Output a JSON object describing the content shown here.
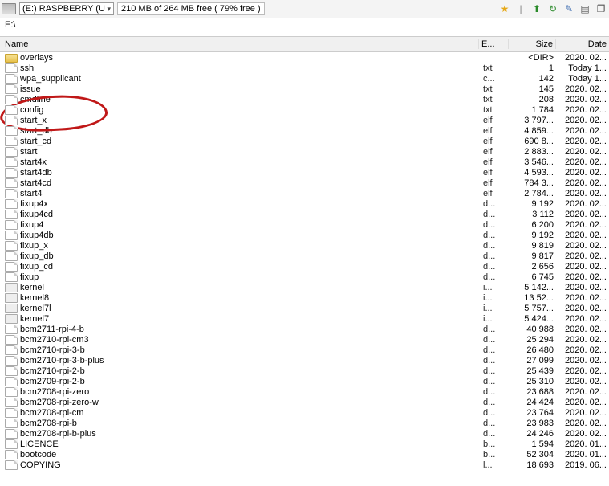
{
  "toolbar": {
    "drive_label": "(E:) RASPBERRY (U",
    "free_space": "210 MB of 264 MB free ( 79% free )"
  },
  "icons": {
    "star": "⭐",
    "sep": "|",
    "up": "⬆",
    "refresh": "↻",
    "tool": "✎",
    "grid": "▤",
    "win": "❐"
  },
  "path": "E:\\",
  "headers": {
    "name": "Name",
    "ext": "E...",
    "size": "Size",
    "date": "Date"
  },
  "files": [
    {
      "icon": "folder",
      "name": "overlays",
      "ext": "",
      "size": "<DIR>",
      "date": "2020. 02..."
    },
    {
      "icon": "file",
      "name": "ssh",
      "ext": "txt",
      "size": "1",
      "date": "Today 1..."
    },
    {
      "icon": "file",
      "name": "wpa_supplicant",
      "ext": "c...",
      "size": "142",
      "date": "Today 1..."
    },
    {
      "icon": "file",
      "name": "issue",
      "ext": "txt",
      "size": "145",
      "date": "2020. 02..."
    },
    {
      "icon": "file",
      "name": "cmdline",
      "ext": "txt",
      "size": "208",
      "date": "2020. 02..."
    },
    {
      "icon": "file",
      "name": "config",
      "ext": "txt",
      "size": "1 784",
      "date": "2020. 02..."
    },
    {
      "icon": "file",
      "name": "start_x",
      "ext": "elf",
      "size": "3 797...",
      "date": "2020. 02..."
    },
    {
      "icon": "file",
      "name": "start_db",
      "ext": "elf",
      "size": "4 859...",
      "date": "2020. 02..."
    },
    {
      "icon": "file",
      "name": "start_cd",
      "ext": "elf",
      "size": "690 8...",
      "date": "2020. 02..."
    },
    {
      "icon": "file",
      "name": "start",
      "ext": "elf",
      "size": "2 883...",
      "date": "2020. 02..."
    },
    {
      "icon": "file",
      "name": "start4x",
      "ext": "elf",
      "size": "3 546...",
      "date": "2020. 02..."
    },
    {
      "icon": "file",
      "name": "start4db",
      "ext": "elf",
      "size": "4 593...",
      "date": "2020. 02..."
    },
    {
      "icon": "file",
      "name": "start4cd",
      "ext": "elf",
      "size": "784 3...",
      "date": "2020. 02..."
    },
    {
      "icon": "file",
      "name": "start4",
      "ext": "elf",
      "size": "2 784...",
      "date": "2020. 02..."
    },
    {
      "icon": "file",
      "name": "fixup4x",
      "ext": "d...",
      "size": "9 192",
      "date": "2020. 02..."
    },
    {
      "icon": "file",
      "name": "fixup4cd",
      "ext": "d...",
      "size": "3 112",
      "date": "2020. 02..."
    },
    {
      "icon": "file",
      "name": "fixup4",
      "ext": "d...",
      "size": "6 200",
      "date": "2020. 02..."
    },
    {
      "icon": "file",
      "name": "fixup4db",
      "ext": "d...",
      "size": "9 192",
      "date": "2020. 02..."
    },
    {
      "icon": "file",
      "name": "fixup_x",
      "ext": "d...",
      "size": "9 819",
      "date": "2020. 02..."
    },
    {
      "icon": "file",
      "name": "fixup_db",
      "ext": "d...",
      "size": "9 817",
      "date": "2020. 02..."
    },
    {
      "icon": "file",
      "name": "fixup_cd",
      "ext": "d...",
      "size": "2 656",
      "date": "2020. 02..."
    },
    {
      "icon": "file",
      "name": "fixup",
      "ext": "d...",
      "size": "6 745",
      "date": "2020. 02..."
    },
    {
      "icon": "bin",
      "name": "kernel",
      "ext": "i...",
      "size": "5 142...",
      "date": "2020. 02..."
    },
    {
      "icon": "bin",
      "name": "kernel8",
      "ext": "i...",
      "size": "13 52...",
      "date": "2020. 02..."
    },
    {
      "icon": "bin",
      "name": "kernel7l",
      "ext": "i...",
      "size": "5 757...",
      "date": "2020. 02..."
    },
    {
      "icon": "bin",
      "name": "kernel7",
      "ext": "i...",
      "size": "5 424...",
      "date": "2020. 02..."
    },
    {
      "icon": "file",
      "name": "bcm2711-rpi-4-b",
      "ext": "d...",
      "size": "40 988",
      "date": "2020. 02..."
    },
    {
      "icon": "file",
      "name": "bcm2710-rpi-cm3",
      "ext": "d...",
      "size": "25 294",
      "date": "2020. 02..."
    },
    {
      "icon": "file",
      "name": "bcm2710-rpi-3-b",
      "ext": "d...",
      "size": "26 480",
      "date": "2020. 02..."
    },
    {
      "icon": "file",
      "name": "bcm2710-rpi-3-b-plus",
      "ext": "d...",
      "size": "27 099",
      "date": "2020. 02..."
    },
    {
      "icon": "file",
      "name": "bcm2710-rpi-2-b",
      "ext": "d...",
      "size": "25 439",
      "date": "2020. 02..."
    },
    {
      "icon": "file",
      "name": "bcm2709-rpi-2-b",
      "ext": "d...",
      "size": "25 310",
      "date": "2020. 02..."
    },
    {
      "icon": "file",
      "name": "bcm2708-rpi-zero",
      "ext": "d...",
      "size": "23 688",
      "date": "2020. 02..."
    },
    {
      "icon": "file",
      "name": "bcm2708-rpi-zero-w",
      "ext": "d...",
      "size": "24 424",
      "date": "2020. 02..."
    },
    {
      "icon": "file",
      "name": "bcm2708-rpi-cm",
      "ext": "d...",
      "size": "23 764",
      "date": "2020. 02..."
    },
    {
      "icon": "file",
      "name": "bcm2708-rpi-b",
      "ext": "d...",
      "size": "23 983",
      "date": "2020. 02..."
    },
    {
      "icon": "file",
      "name": "bcm2708-rpi-b-plus",
      "ext": "d...",
      "size": "24 246",
      "date": "2020. 02..."
    },
    {
      "icon": "file",
      "name": "LICENCE",
      "ext": "b...",
      "size": "1 594",
      "date": "2020. 01..."
    },
    {
      "icon": "file",
      "name": "bootcode",
      "ext": "b...",
      "size": "52 304",
      "date": "2020. 01..."
    },
    {
      "icon": "file",
      "name": "COPYING",
      "ext": "l...",
      "size": "18 693",
      "date": "2019. 06..."
    }
  ]
}
